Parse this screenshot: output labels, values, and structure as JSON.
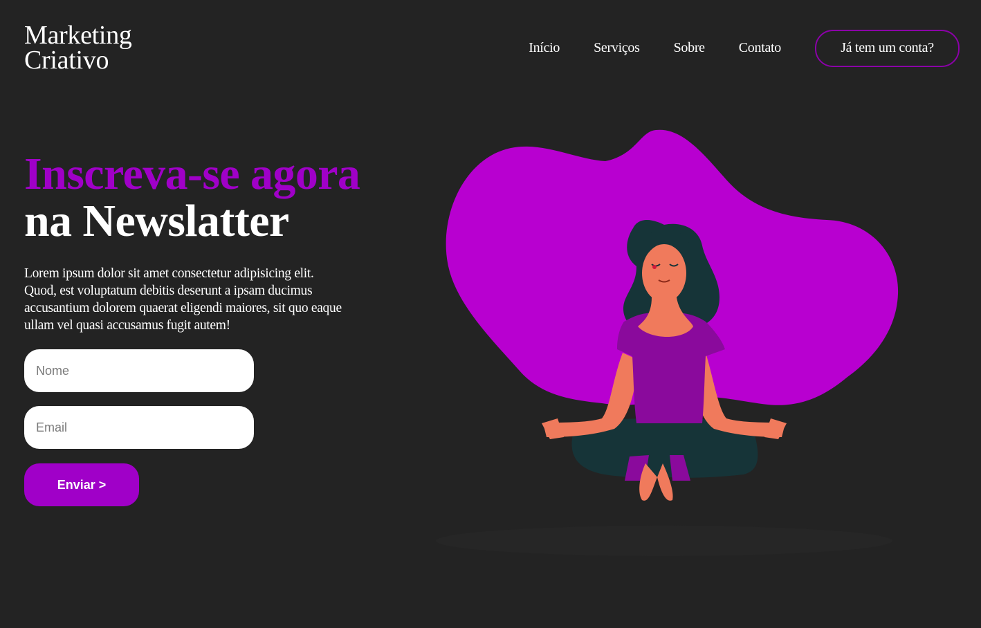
{
  "brand": {
    "line1": "Marketing",
    "line2": "Criativo"
  },
  "nav": {
    "items": [
      "Início",
      "Serviços",
      "Sobre",
      "Contato"
    ],
    "account_button": "Já tem um conta?"
  },
  "hero": {
    "title_accent": "Inscreva-se agora",
    "title_rest": "na Newslatter",
    "description": "Lorem ipsum dolor sit amet consectetur adipisicing elit. Quod, est voluptatum debitis deserunt a ipsam ducimus accusantium dolorem quaerat eligendi maiores, sit quo eaque ullam vel quasi accusamus fugit autem!"
  },
  "form": {
    "name_placeholder": "Nome",
    "email_placeholder": "Email",
    "submit_label": "Enviar >"
  },
  "colors": {
    "background": "#232323",
    "accent": "#a000c8",
    "blob": "#b800d0",
    "skin": "#f07a5c",
    "hair": "#163438",
    "shirt": "#8a0a9c"
  },
  "illustration": {
    "icon": "meditating-woman-illustration"
  }
}
